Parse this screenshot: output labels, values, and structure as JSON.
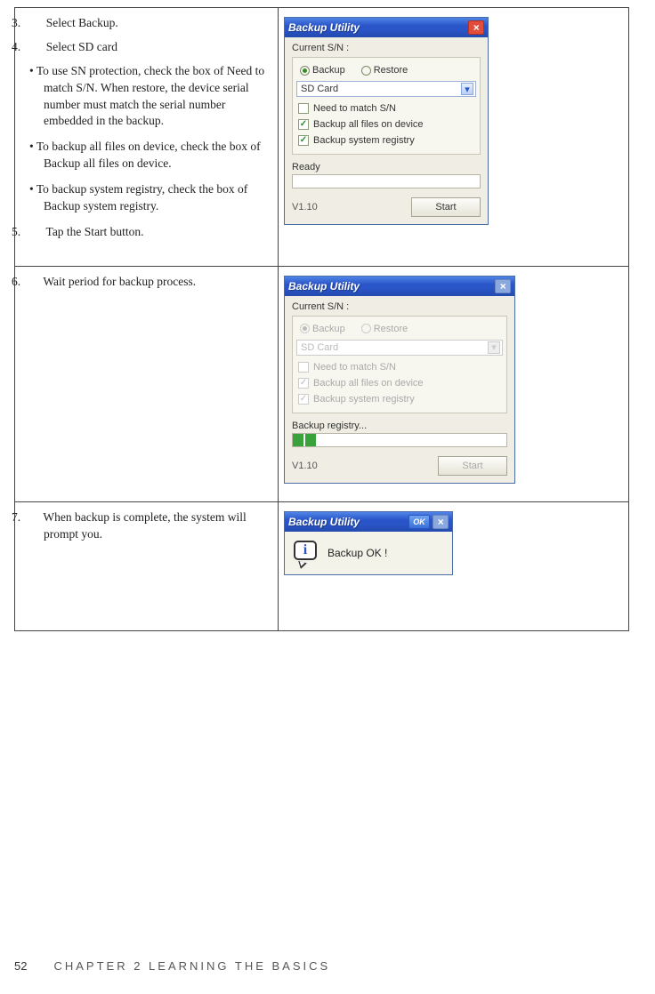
{
  "steps": {
    "row1": {
      "s3": "Select Backup.",
      "s4": "Select SD card",
      "b1": "To use SN protection, check the box of Need to match S/N. When restore, the device serial number must match the serial number embedded in the backup.",
      "b2": "To backup all files on device, check the box of Backup all files on device.",
      "b3": "To backup system registry, check the box of Backup system registry.",
      "s5": "Tap the Start button."
    },
    "row2": {
      "s6": "Wait period for backup process."
    },
    "row3": {
      "s7": "When backup is complete, the system will prompt you."
    }
  },
  "win": {
    "title": "Backup Utility",
    "current_sn": "Current S/N :",
    "radio_backup": "Backup",
    "radio_restore": "Restore",
    "select_value": "SD Card",
    "chk_sn": "Need to match S/N",
    "chk_all": "Backup all files on device",
    "chk_reg": "Backup system registry",
    "status_ready": "Ready",
    "status_running": "Backup registry...",
    "version": "V1.10",
    "start": "Start"
  },
  "msg": {
    "title": "Backup Utility",
    "ok": "OK",
    "text": "Backup OK !"
  },
  "footer": {
    "page": "52",
    "chapter": "CHAPTER 2 LEARNING THE BASICS"
  }
}
